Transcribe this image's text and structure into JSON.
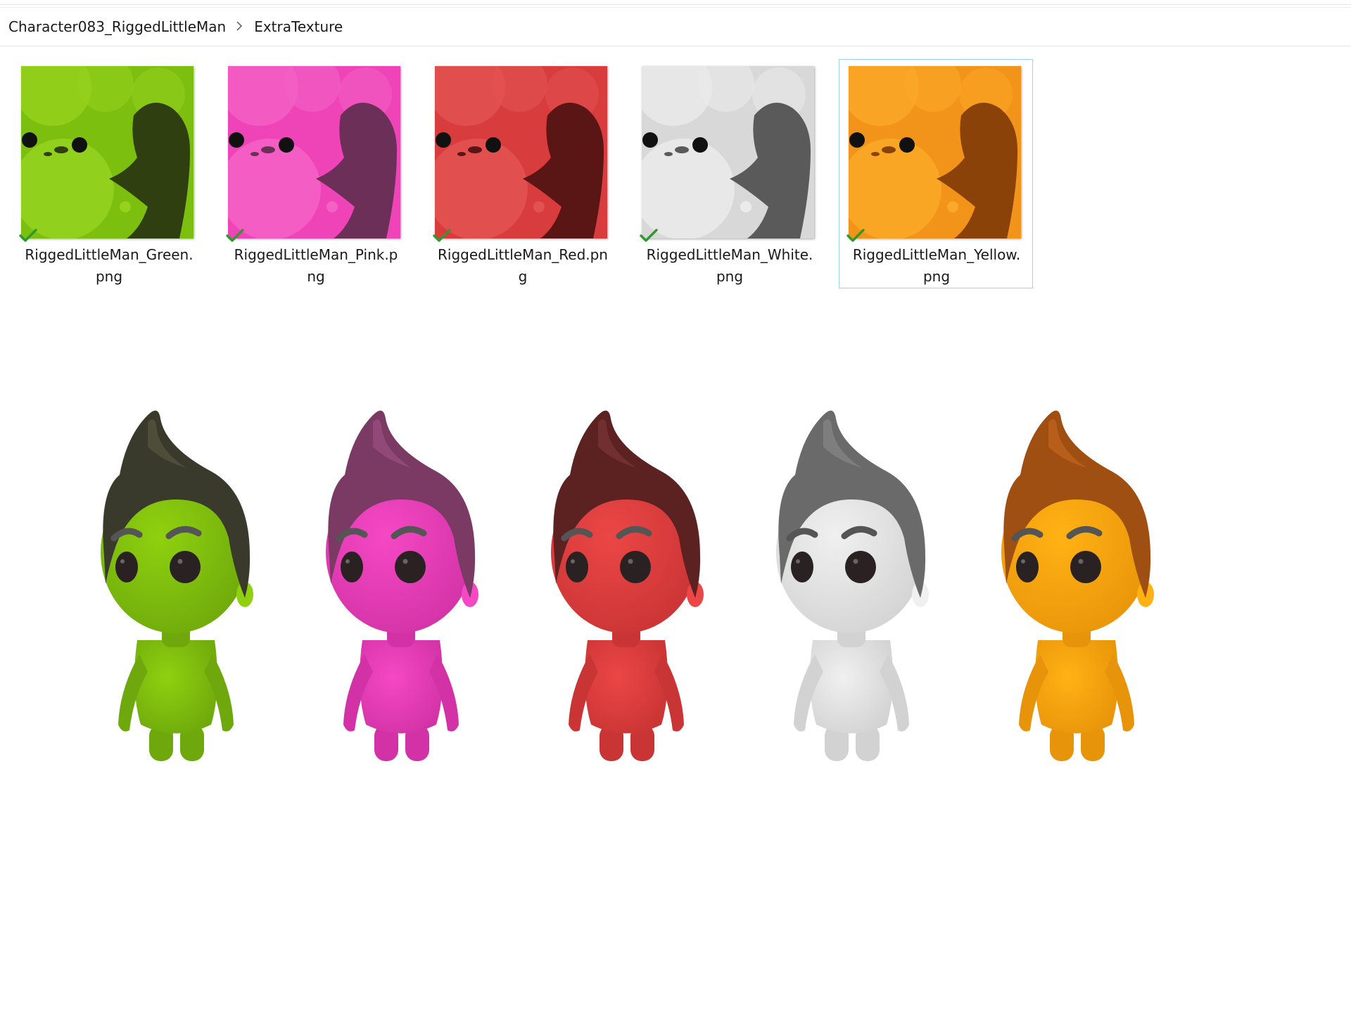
{
  "breadcrumb": {
    "items": [
      "Character083_RiggedLittleMan",
      "ExtraTexture"
    ]
  },
  "files": [
    {
      "name": "RiggedLittleMan_Green.png",
      "base": "#7cbf0e",
      "light": "#95d21e",
      "dark": "#2f3f10",
      "selected": false
    },
    {
      "name": "RiggedLittleMan_Pink.png",
      "base": "#ee44b8",
      "light": "#f461c4",
      "dark": "#6b2f58",
      "selected": false
    },
    {
      "name": "RiggedLittleMan_Red.png",
      "base": "#d83c3c",
      "light": "#e35252",
      "dark": "#5a1515",
      "selected": false
    },
    {
      "name": "RiggedLittleMan_White.png",
      "base": "#d8d8d8",
      "light": "#ebebeb",
      "dark": "#5a5a5a",
      "selected": false
    },
    {
      "name": "RiggedLittleMan_Yellow.png",
      "base": "#f2931a",
      "light": "#fba928",
      "dark": "#8a4208",
      "selected": true
    }
  ],
  "characters": [
    {
      "skin": "#8fd10f",
      "skin_shade": "#6ea80c",
      "hair": "#3a3a2c",
      "hair_hi": "#55553f"
    },
    {
      "skin": "#f548c4",
      "skin_shade": "#d232a6",
      "hair": "#7a3a64",
      "hair_hi": "#9a5080"
    },
    {
      "skin": "#ec4646",
      "skin_shade": "#c93434",
      "hair": "#5c2222",
      "hair_hi": "#7a3434"
    },
    {
      "skin": "#f0f0f0",
      "skin_shade": "#d2d2d2",
      "hair": "#6a6a6a",
      "hair_hi": "#888888"
    },
    {
      "skin": "#ffb214",
      "skin_shade": "#e8940a",
      "hair": "#a04f12",
      "hair_hi": "#c0661e"
    }
  ],
  "icons": {
    "sync_check": "check-icon",
    "breadcrumb_sep": "chevron-right-icon"
  }
}
